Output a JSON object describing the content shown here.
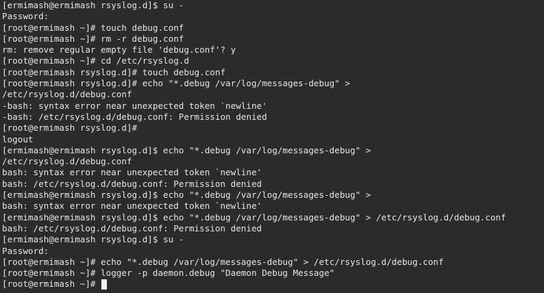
{
  "terminal": {
    "lines": [
      "[ermimash@ermimash rsyslog.d]$ su -",
      "Password:",
      "[root@ermimash ~]# touch debug.conf",
      "[root@ermimash ~]# rm -r debug.conf",
      "rm: remove regular empty file 'debug.conf'? y",
      "[root@ermimash ~]# cd /etc/rsyslog.d",
      "[root@ermimash rsyslog.d]# touch debug.conf",
      "[root@ermimash rsyslog.d]# echo \"*.debug /var/log/messages-debug\" >",
      "/etc/rsyslog.d/debug.conf",
      "-bash: syntax error near unexpected token `newline'",
      "-bash: /etc/rsyslog.d/debug.conf: Permission denied",
      "[root@ermimash rsyslog.d]#",
      "logout",
      "[ermimash@ermimash rsyslog.d]$ echo \"*.debug /var/log/messages-debug\" >",
      "/etc/rsyslog.d/debug.conf",
      "bash: syntax error near unexpected token `newline'",
      "bash: /etc/rsyslog.d/debug.conf: Permission denied",
      "[ermimash@ermimash rsyslog.d]$ echo \"*.debug /var/log/messages-debug\" >",
      "bash: syntax error near unexpected token `newline'",
      "[ermimash@ermimash rsyslog.d]$ echo \"*.debug /var/log/messages-debug\" > /etc/rsyslog.d/debug.conf",
      "bash: /etc/rsyslog.d/debug.conf: Permission denied",
      "[ermimash@ermimash rsyslog.d]$ su -",
      "Password:",
      "[root@ermimash ~]# echo \"*.debug /var/log/messages-debug\" > /etc/rsyslog.d/debug.conf",
      "[root@ermimash ~]# logger -p daemon.debug \"Daemon Debug Message\""
    ],
    "prompt": "[root@ermimash ~]# ",
    "colors": {
      "background": "#2b2b2b",
      "foreground": "#e6e6e6",
      "cursor": "#f2f2f2"
    }
  }
}
